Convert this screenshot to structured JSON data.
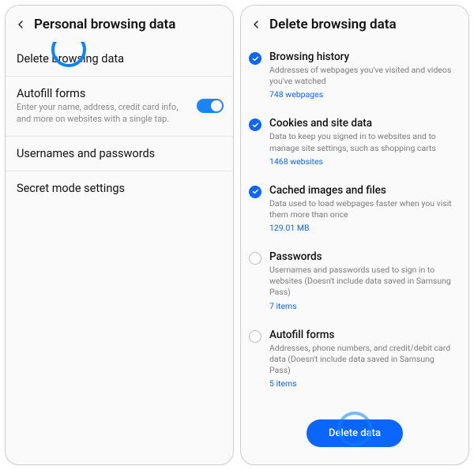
{
  "left": {
    "title": "Personal browsing data",
    "rows": {
      "delete": "Delete browsing data",
      "autofill_title": "Autofill forms",
      "autofill_sub": "Enter your name, address, credit card info, and more on websites with a single tap.",
      "usernames": "Usernames and passwords",
      "secret": "Secret mode settings"
    }
  },
  "right": {
    "title": "Delete browsing data",
    "options": {
      "history": {
        "title": "Browsing history",
        "desc": "Addresses of webpages you've visited and videos you've watched",
        "count": "748 webpages"
      },
      "cookies": {
        "title": "Cookies and site data",
        "desc": "Data to keep you signed in to websites and to manage site settings, such as shopping carts",
        "count": "1468 websites"
      },
      "cache": {
        "title": "Cached images and files",
        "desc": "Data used to load webpages faster when you visit them more than once",
        "count": "129.01 MB"
      },
      "passwords": {
        "title": "Passwords",
        "desc": "Usernames and passwords used to sign in to websites (Doesn't include data saved in Samsung Pass)",
        "count": "7 items"
      },
      "autofill": {
        "title": "Autofill forms",
        "desc": "Addresses, phone numbers, and credit/debit card data (Doesn't include data saved in Samsung Pass)",
        "count": "5 items"
      }
    },
    "delete_button": "Delete data"
  }
}
